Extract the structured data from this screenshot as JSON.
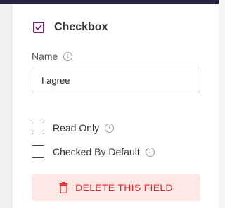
{
  "field": {
    "type_label": "Checkbox",
    "type_icon": "checkbox-checked-icon",
    "accent_color": "#6e2a6b"
  },
  "name": {
    "label": "Name",
    "value": "I agree",
    "info_icon": "info-icon"
  },
  "options": [
    {
      "label": "Read Only",
      "checked": false
    },
    {
      "label": "Checked By Default",
      "checked": false
    }
  ],
  "delete": {
    "label": "DELETE THIS FIELD",
    "icon": "trash-icon",
    "color": "#d92d2d"
  }
}
